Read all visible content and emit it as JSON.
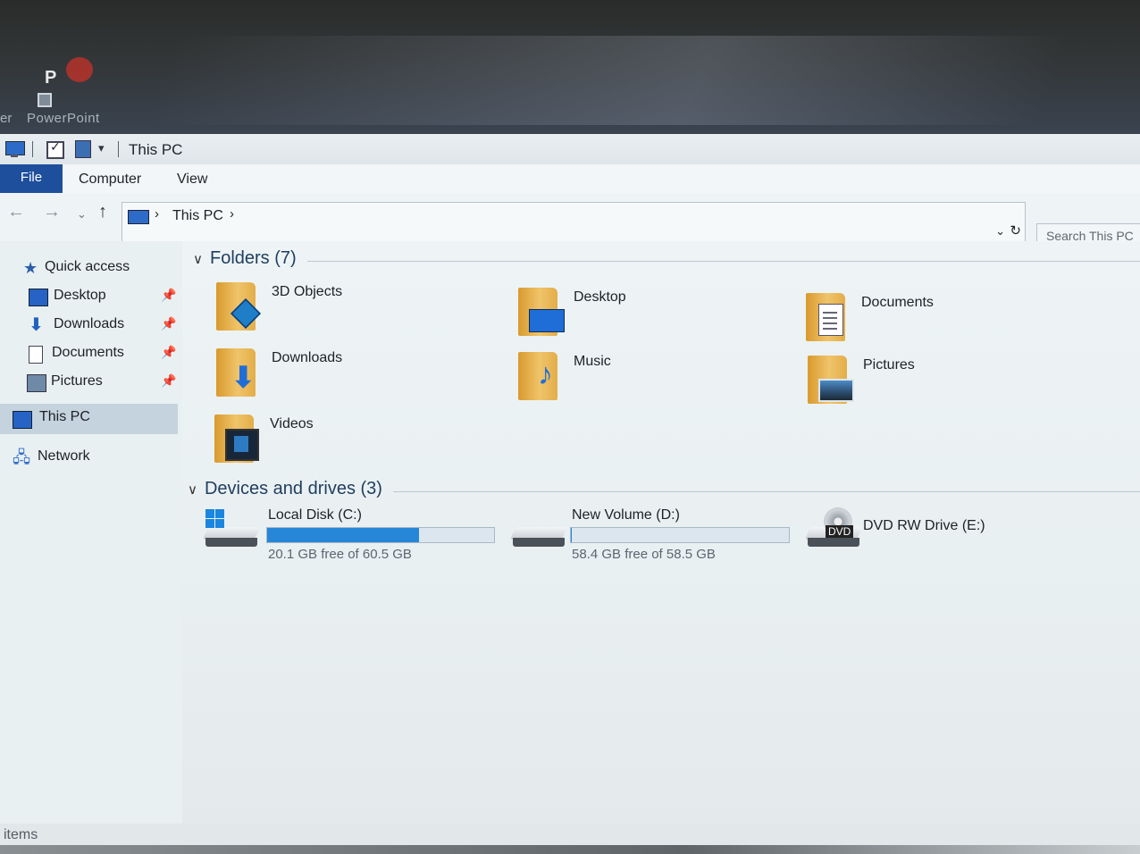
{
  "desktop": {
    "icon_label": "PowerPoint",
    "icon_glyph": "P",
    "partial_label_left": "er"
  },
  "titlebar": {
    "title": "This PC",
    "qa_dropdown": "▾"
  },
  "ribbon": {
    "tabs": [
      "File",
      "Computer",
      "View"
    ]
  },
  "nav": {
    "back": "←",
    "forward": "→",
    "recent": "⌄",
    "up": "↑",
    "breadcrumb": "This PC",
    "chevron": "›",
    "dropdown": "⌄",
    "refresh": "↻",
    "search_placeholder": "Search This PC"
  },
  "sidebar": {
    "items": [
      {
        "label": "Quick access",
        "icon": "star-icon"
      },
      {
        "label": "Desktop",
        "icon": "desktop-icon",
        "pinned": true
      },
      {
        "label": "Downloads",
        "icon": "download-icon",
        "pinned": true
      },
      {
        "label": "Documents",
        "icon": "documents-icon",
        "pinned": true
      },
      {
        "label": "Pictures",
        "icon": "pictures-icon",
        "pinned": true
      },
      {
        "label": "This PC",
        "icon": "pc-icon",
        "selected": true
      },
      {
        "label": "Network",
        "icon": "network-icon"
      }
    ],
    "pin_glyph": "📌"
  },
  "content": {
    "folders_header": "Folders (7)",
    "devices_header": "Devices and drives (3)",
    "collapse_glyph": "∨",
    "folders": [
      {
        "name": "3D Objects",
        "icon": "3d-objects-folder-icon"
      },
      {
        "name": "Desktop",
        "icon": "desktop-folder-icon"
      },
      {
        "name": "Documents",
        "icon": "documents-folder-icon"
      },
      {
        "name": "Downloads",
        "icon": "downloads-folder-icon"
      },
      {
        "name": "Music",
        "icon": "music-folder-icon"
      },
      {
        "name": "Pictures",
        "icon": "pictures-folder-icon"
      },
      {
        "name": "Videos",
        "icon": "videos-folder-icon"
      }
    ],
    "drives": [
      {
        "name": "Local Disk (C:)",
        "free_text": "20.1 GB free of 60.5 GB",
        "used_fraction": 0.668
      },
      {
        "name": "New Volume (D:)",
        "free_text": "58.4 GB free of 58.5 GB",
        "used_fraction": 0.002
      },
      {
        "name": "DVD RW Drive (E:)",
        "badge": "DVD"
      }
    ]
  },
  "status": {
    "text": "items"
  },
  "colors": {
    "accent": "#1d4f9c",
    "selection": "#c5d3de",
    "progress": "#2687d8"
  }
}
